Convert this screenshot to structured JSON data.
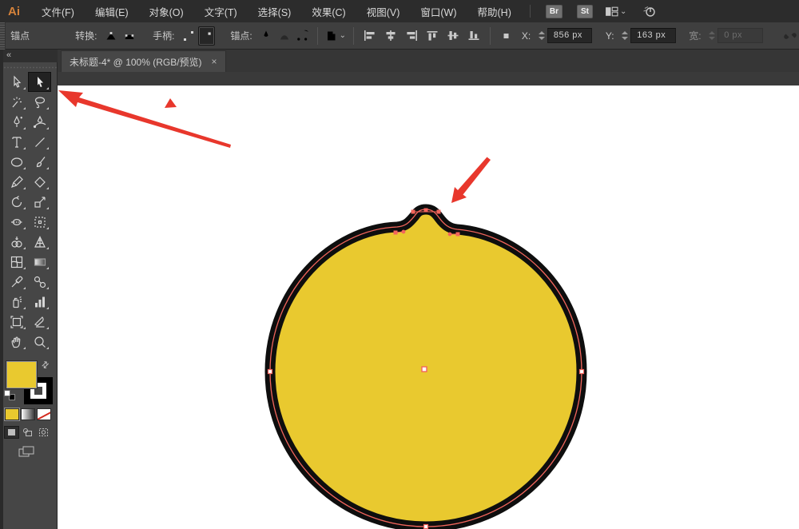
{
  "app": {
    "logo_text": "Ai"
  },
  "menubar": {
    "items": [
      "文件(F)",
      "编辑(E)",
      "对象(O)",
      "文字(T)",
      "选择(S)",
      "效果(C)",
      "视图(V)",
      "窗口(W)",
      "帮助(H)"
    ],
    "bridge_label": "Br",
    "stock_label": "St",
    "icons": [
      "workspace-switcher-icon",
      "chevron-down-icon",
      "launch-icon"
    ]
  },
  "controlbar": {
    "context_label": "锚点",
    "convert_label": "转换:",
    "handles_label": "手柄:",
    "anchors_label": "锚点:",
    "convert_items": [
      "convert-to-corner-icon",
      "convert-to-smooth-icon"
    ],
    "handle_items": [
      "show-handles-icon",
      "hide-handles-icon"
    ],
    "anchor_items": [
      "remove-anchor-pen-icon",
      "connect-path-icon",
      "cut-path-icon"
    ],
    "isolate_icon": "isolate-object-icon",
    "align_items": [
      "align-left",
      "align-center-horizontal",
      "align-right",
      "align-top",
      "align-middle-vertical",
      "align-bottom"
    ],
    "anchor_offset_icon": "anchor-point-icon",
    "x_label": "X:",
    "x_value": "856 px",
    "y_label": "Y:",
    "y_value": "163 px",
    "width_label": "宽:",
    "width_value": "0 px",
    "link_icon": "broken-chain-icon"
  },
  "tabbar": {
    "title": "未标题-4* @ 100% (RGB/预览)",
    "close_glyph": "×"
  },
  "tools": {
    "collapse_glyph": "«",
    "selected": "direct-selection-tool",
    "items": [
      "selection-tool",
      "direct-selection-tool",
      "magic-wand-tool",
      "lasso-tool",
      "pen-tool",
      "curvature-tool",
      "type-tool",
      "line-segment-tool",
      "ellipse-tool",
      "paintbrush-tool",
      "shaper-tool",
      "eraser-tool",
      "rotate-tool",
      "scale-tool",
      "width-tool",
      "free-transform-tool",
      "shape-builder-tool",
      "perspective-grid-tool",
      "mesh-tool",
      "gradient-tool",
      "eyedropper-tool",
      "blend-tool",
      "symbol-sprayer-tool",
      "column-graph-tool",
      "artboard-tool",
      "slice-tool",
      "hand-tool",
      "zoom-tool"
    ]
  },
  "swatches": {
    "fill_color": "#E9C92F",
    "stroke_color": "#000000"
  },
  "canvas": {
    "shape_fill": "#E9C92F",
    "shape_outline": "#0E0E0E",
    "selection_color": "#F2655C",
    "annotation_color": "#E8372C"
  }
}
